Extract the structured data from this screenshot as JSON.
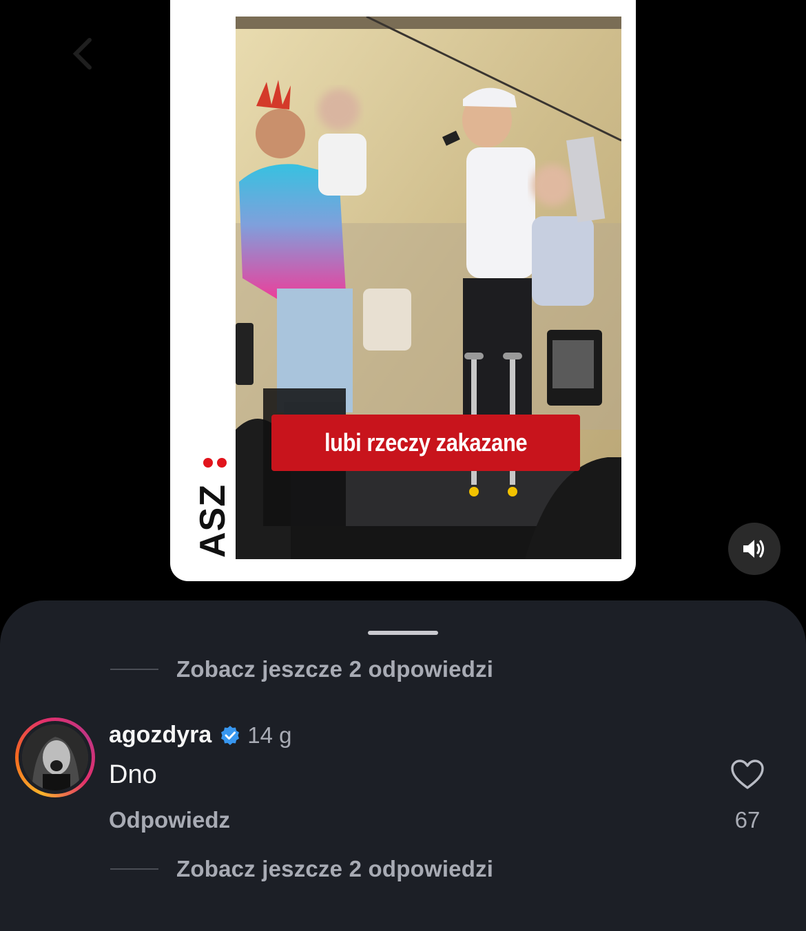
{
  "post": {
    "caption_overlay": "lubi rzeczy zakazane",
    "brand_logo": "ASZ"
  },
  "sound": {
    "icon": "speaker-on-icon"
  },
  "comments": {
    "view_replies_top": "Zobacz jeszcze 2 odpowiedzi",
    "comment": {
      "username": "agozdyra",
      "verified": true,
      "time": "14 g",
      "text": "Dno",
      "reply_label": "Odpowiedz",
      "likes": "67"
    },
    "view_replies_bottom": "Zobacz jeszcze 2 odpowiedzi"
  },
  "colors": {
    "background": "#000000",
    "sheet": "#1c1f26",
    "caption_bg": "#c8141c",
    "brand_red": "#e1141c",
    "verified_blue": "#3897f0",
    "muted_text": "#a8abb4"
  }
}
